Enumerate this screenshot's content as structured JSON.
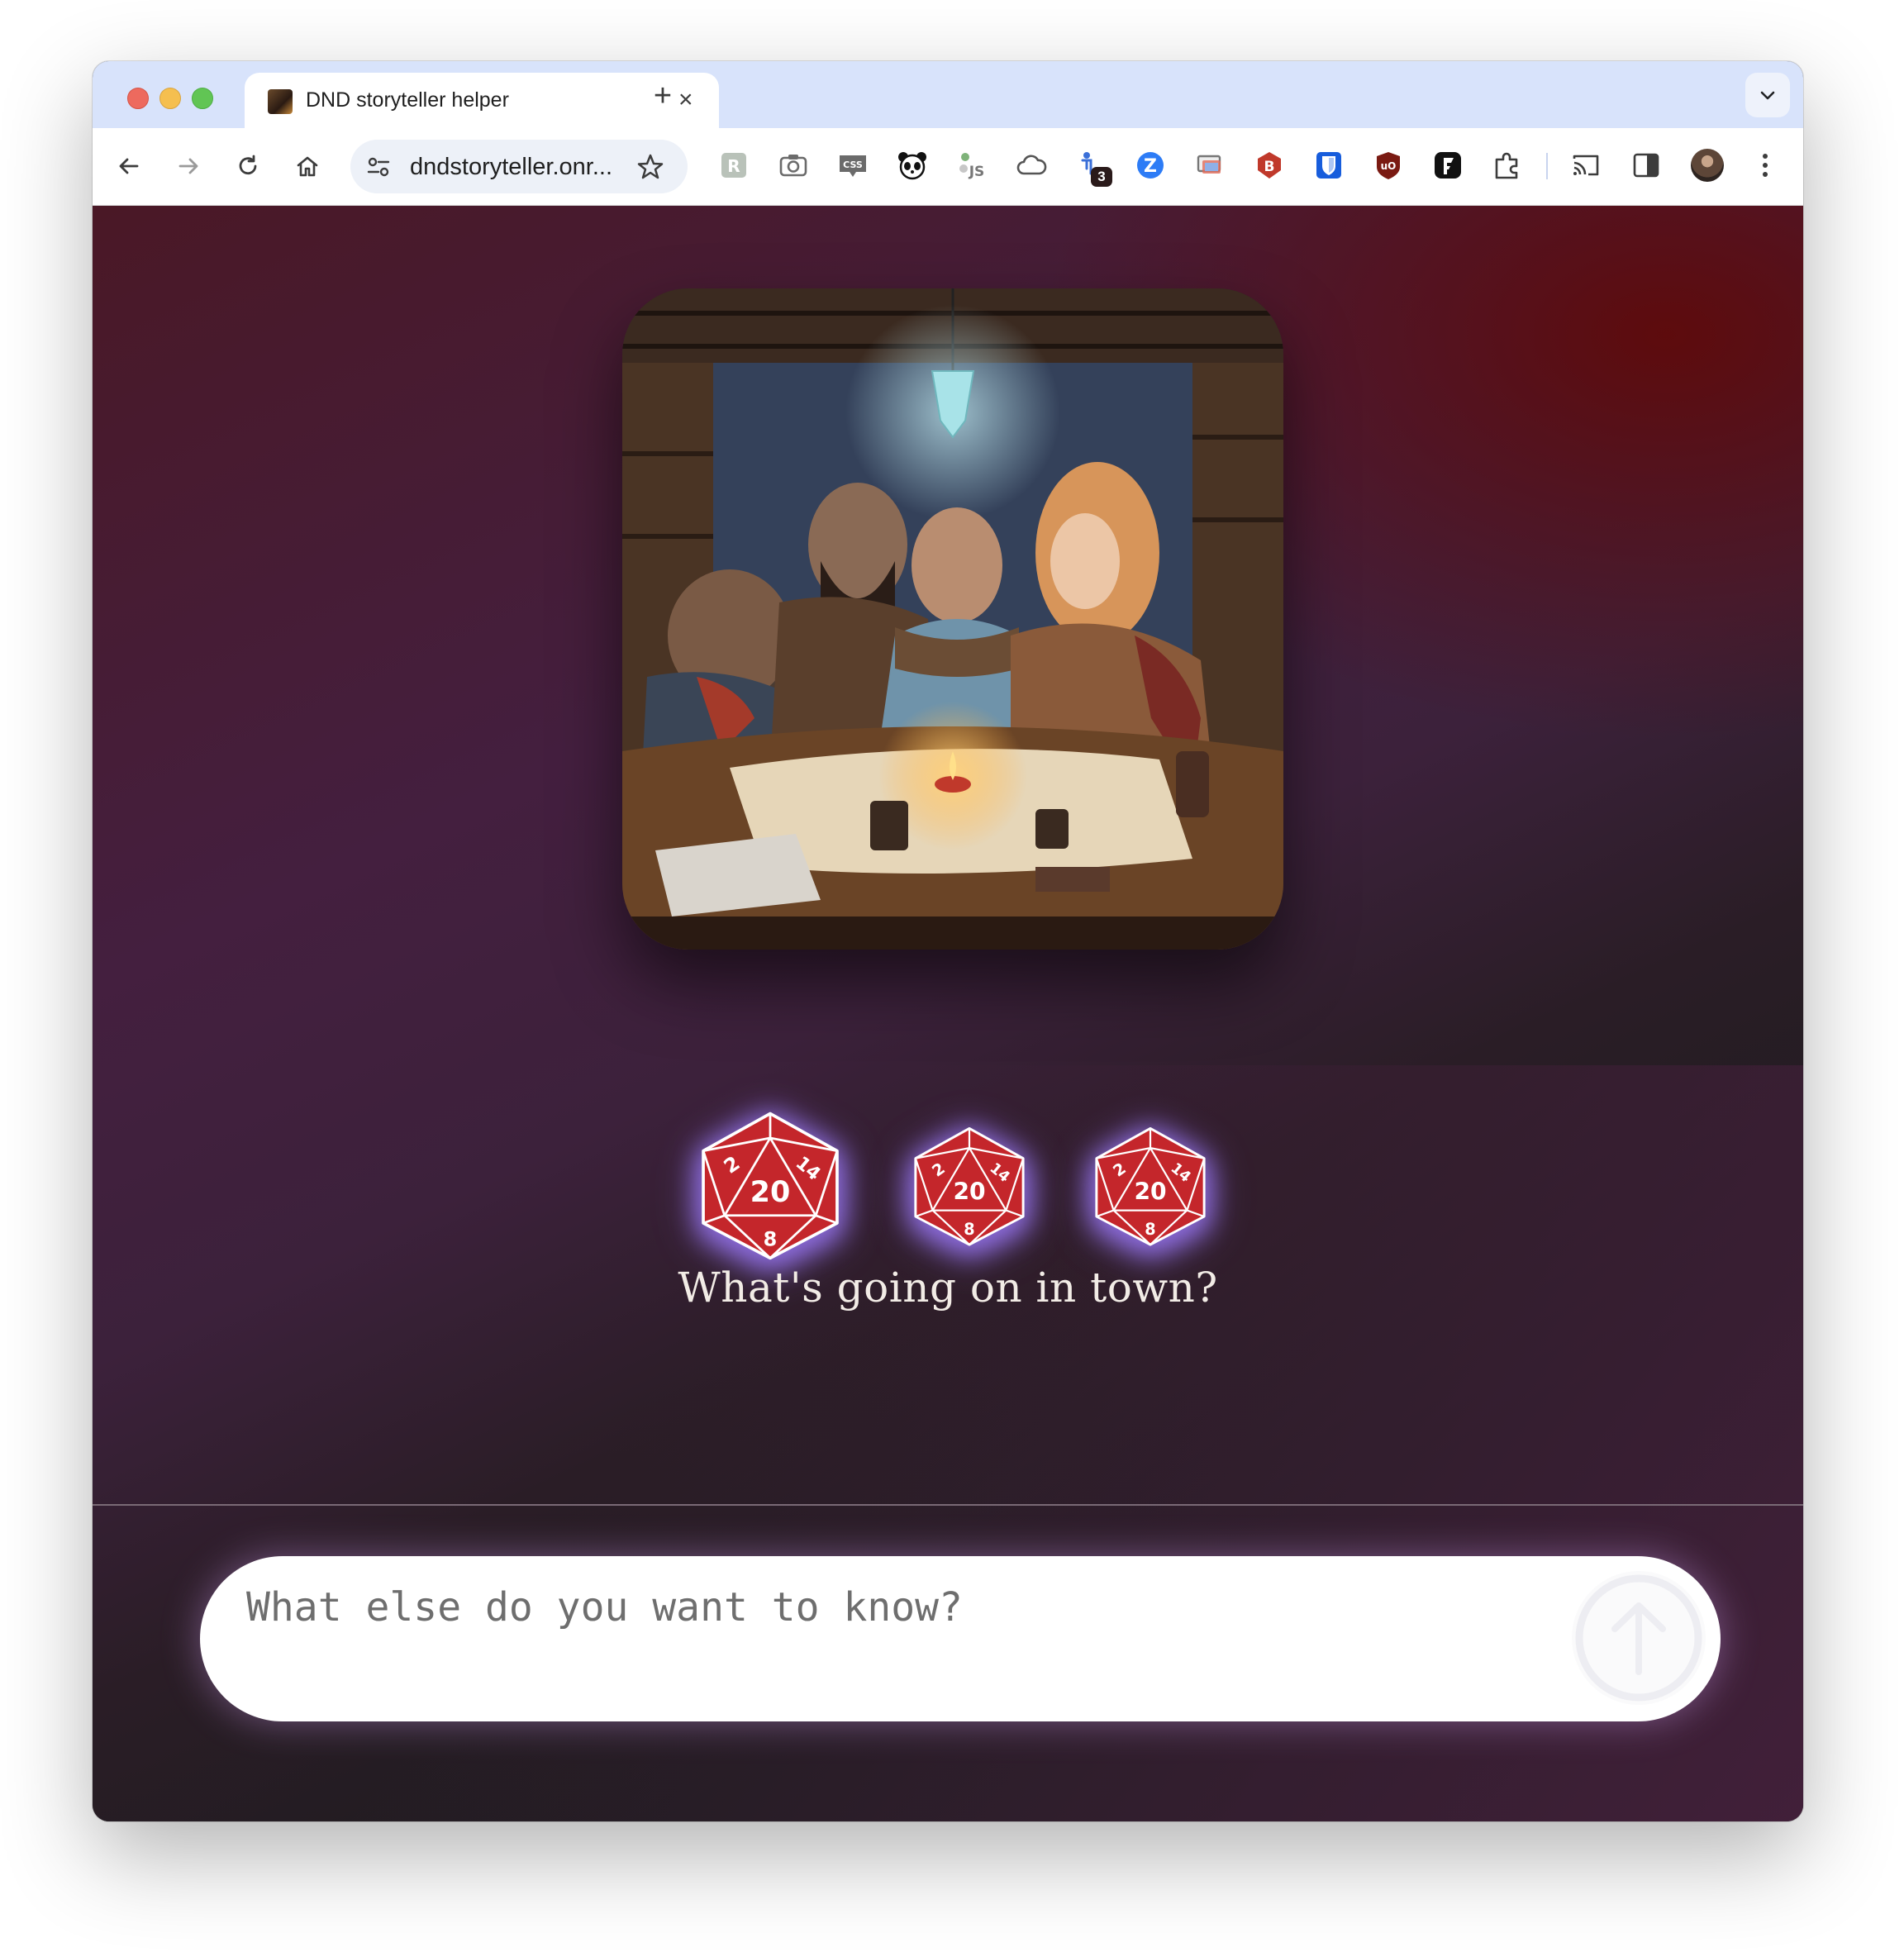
{
  "browser": {
    "tab_title": "DND storyteller helper",
    "new_tab_symbol": "+",
    "close_symbol": "×",
    "url": "dndstoryteller.onr...",
    "extension_badge_count": "3"
  },
  "icons": {
    "nav": [
      "back-icon",
      "forward-icon",
      "reload-icon",
      "home-icon"
    ],
    "omnibox": [
      "site-settings-icon",
      "bookmark-star-icon"
    ],
    "extensions": [
      "regex-extension-icon",
      "camera-extension-icon",
      "css-extension-icon",
      "panda-extension-icon",
      "js-extension-icon",
      "cloud-extension-icon",
      "accessibility-extension-icon",
      "zoom-extension-icon",
      "screen-extension-icon",
      "b-shield-extension-icon",
      "bitwarden-extension-icon",
      "ublock-extension-icon",
      "f-extension-icon",
      "puzzle-extensions-icon"
    ],
    "right": [
      "cast-icon",
      "side-panel-icon",
      "profile-avatar",
      "more-menu-icon"
    ]
  },
  "page": {
    "hero_image": "adventurers-around-map-table-illustration",
    "dice": [
      {
        "name": "d20-die",
        "face": "20",
        "top": "8",
        "left": "2",
        "right": "14",
        "state": "selected"
      },
      {
        "name": "d20-die",
        "face": "20",
        "top": "8",
        "left": "2",
        "right": "14"
      },
      {
        "name": "d20-die",
        "face": "20",
        "top": "8",
        "left": "2",
        "right": "14"
      }
    ],
    "prompt": "What's going on in town?",
    "chat_placeholder": "What else do you want to know?",
    "send_icon": "arrow-up-icon"
  },
  "colors": {
    "die_red": "#c4262b",
    "die_glow": "#8a6ad8",
    "page_red": "#5f0a0a",
    "page_purple": "#441f3f",
    "page_dark": "#1c1c1f"
  }
}
